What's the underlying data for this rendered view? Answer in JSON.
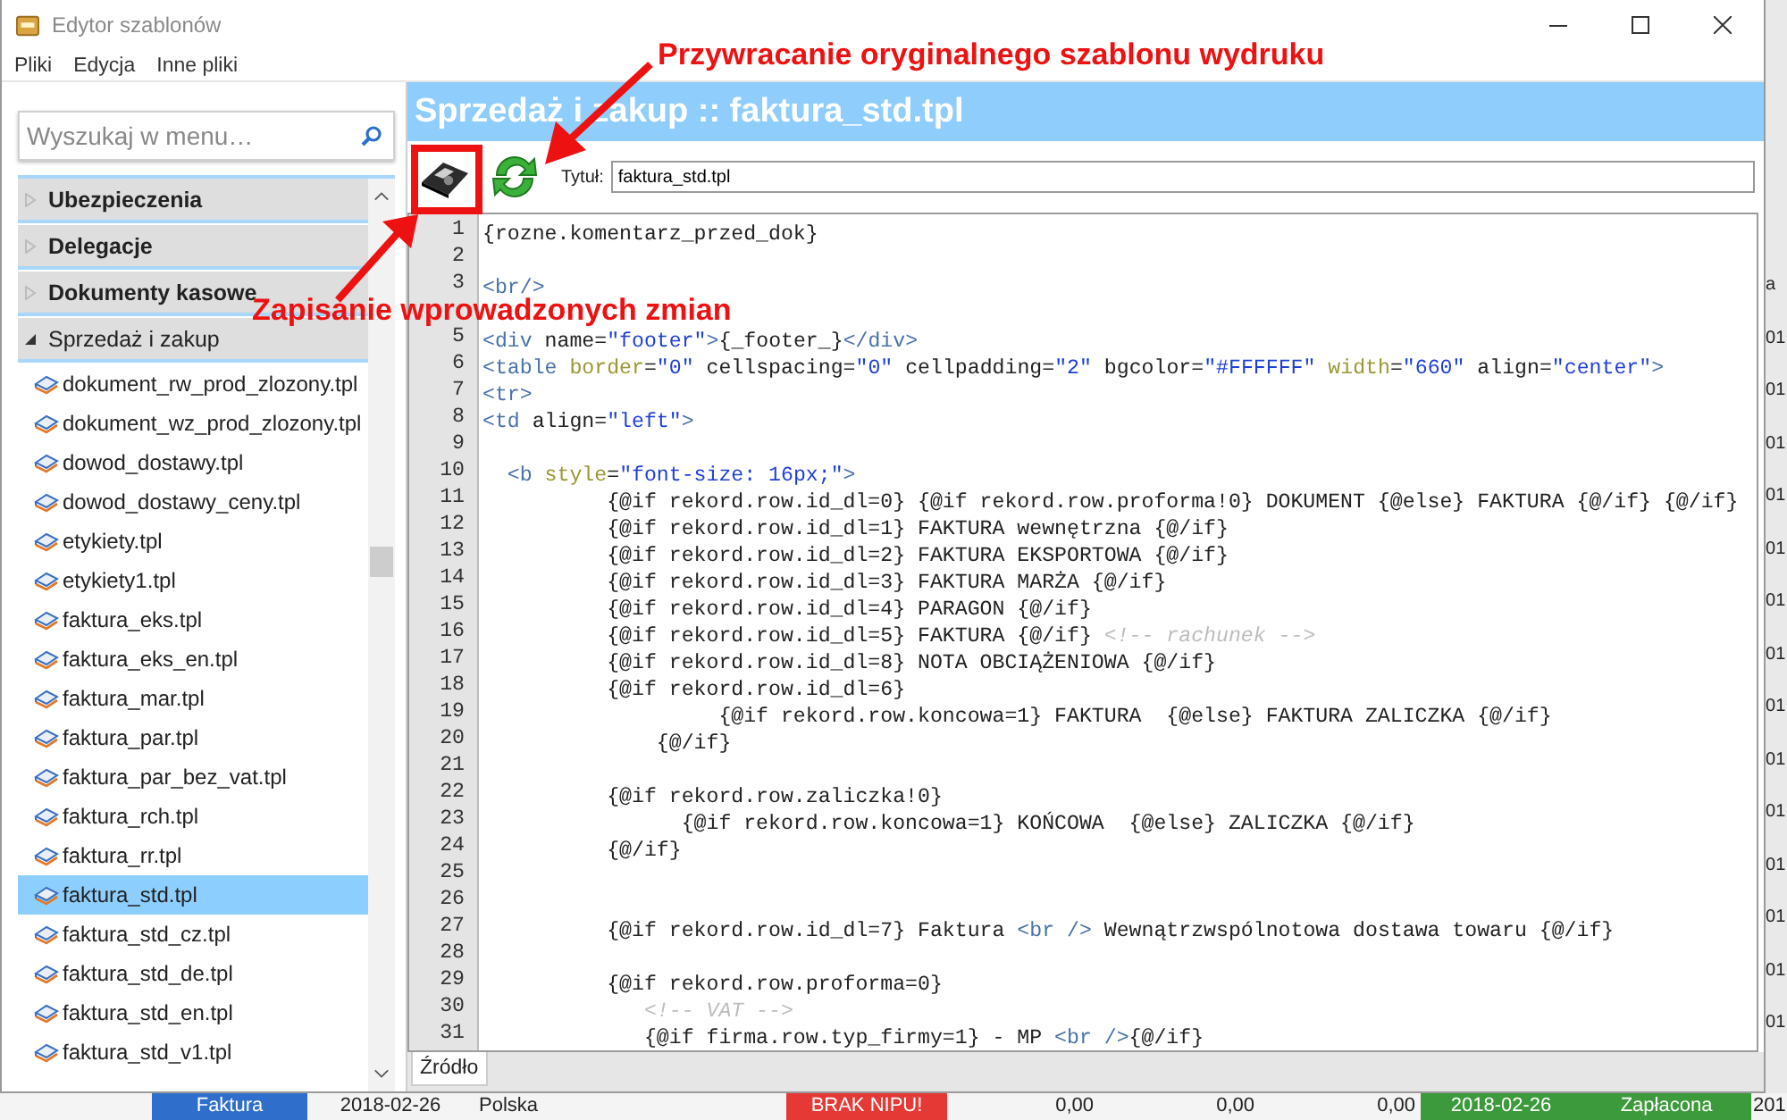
{
  "window": {
    "title": "Edytor szablonów"
  },
  "menu": [
    "Pliki",
    "Edycja",
    "Inne pliki"
  ],
  "search": {
    "placeholder": "Wyszukaj w menu…"
  },
  "tree": [
    {
      "label": "Ubezpieczenia",
      "expanded": false
    },
    {
      "label": "Delegacje",
      "expanded": false
    },
    {
      "label": "Dokumenty kasowe",
      "expanded": false
    },
    {
      "label": "Sprzedaż i zakup",
      "expanded": true,
      "children": [
        {
          "label": "dokument_rw_prod_zlozony.tpl",
          "selected": false
        },
        {
          "label": "dokument_wz_prod_zlozony.tpl",
          "selected": false
        },
        {
          "label": "dowod_dostawy.tpl",
          "selected": false
        },
        {
          "label": "dowod_dostawy_ceny.tpl",
          "selected": false
        },
        {
          "label": "etykiety.tpl",
          "selected": false
        },
        {
          "label": "etykiety1.tpl",
          "selected": false
        },
        {
          "label": "faktura_eks.tpl",
          "selected": false
        },
        {
          "label": "faktura_eks_en.tpl",
          "selected": false
        },
        {
          "label": "faktura_mar.tpl",
          "selected": false
        },
        {
          "label": "faktura_par.tpl",
          "selected": false
        },
        {
          "label": "faktura_par_bez_vat.tpl",
          "selected": false
        },
        {
          "label": "faktura_rch.tpl",
          "selected": false
        },
        {
          "label": "faktura_rr.tpl",
          "selected": false
        },
        {
          "label": "faktura_std.tpl",
          "selected": true
        },
        {
          "label": "faktura_std_cz.tpl",
          "selected": false
        },
        {
          "label": "faktura_std_de.tpl",
          "selected": false
        },
        {
          "label": "faktura_std_en.tpl",
          "selected": false
        },
        {
          "label": "faktura_std_v1.tpl",
          "selected": false
        }
      ]
    }
  ],
  "editor": {
    "heading": "Sprzedaż i zakup :: faktura_std.tpl",
    "title_label": "Tytuł:",
    "title_value": "faktura_std.tpl",
    "lines": [
      {
        "number": "1",
        "segments": [
          {
            "kind": "plain",
            "text": "{rozne.komentarz_przed_dok}"
          }
        ]
      },
      {
        "number": "2"
      },
      {
        "number": "3",
        "segments": [
          {
            "kind": "tag",
            "text": "<br/>"
          }
        ]
      },
      {
        "kind": "covered"
      },
      {
        "number": "5",
        "segments": [
          {
            "kind": "tag",
            "text": "<div"
          },
          {
            "kind": "plain",
            "text": " name="
          },
          {
            "kind": "string",
            "text": "\"footer\""
          },
          {
            "kind": "tag",
            "text": ">"
          },
          {
            "kind": "plain",
            "text": "{_footer_}"
          },
          {
            "kind": "tag",
            "text": "</div>"
          }
        ]
      },
      {
        "number": "6",
        "segments": [
          {
            "kind": "tag",
            "text": "<table"
          },
          {
            "kind": "attr",
            "text": " border"
          },
          {
            "kind": "plain",
            "text": "="
          },
          {
            "kind": "string",
            "text": "\"0\""
          },
          {
            "kind": "plain",
            "text": " cellspacing="
          },
          {
            "kind": "string",
            "text": "\"0\""
          },
          {
            "kind": "plain",
            "text": " cellpadding="
          },
          {
            "kind": "string",
            "text": "\"2\""
          },
          {
            "kind": "plain",
            "text": " bgcolor="
          },
          {
            "kind": "string",
            "text": "\"#FFFFFF\""
          },
          {
            "kind": "attr",
            "text": " width"
          },
          {
            "kind": "plain",
            "text": "="
          },
          {
            "kind": "string",
            "text": "\"660\""
          },
          {
            "kind": "plain",
            "text": " align="
          },
          {
            "kind": "string",
            "text": "\"center\""
          },
          {
            "kind": "tag",
            "text": ">"
          }
        ]
      },
      {
        "number": "7",
        "segments": [
          {
            "kind": "tag",
            "text": "<tr>"
          }
        ]
      },
      {
        "number": "8",
        "segments": [
          {
            "kind": "tag",
            "text": "<td"
          },
          {
            "kind": "plain",
            "text": " align="
          },
          {
            "kind": "string",
            "text": "\"left\""
          },
          {
            "kind": "tag",
            "text": ">"
          }
        ]
      },
      {
        "number": "9"
      },
      {
        "number": "10",
        "segments": [
          {
            "kind": "tag",
            "text": "  <b"
          },
          {
            "kind": "attr",
            "text": " style"
          },
          {
            "kind": "plain",
            "text": "="
          },
          {
            "kind": "string",
            "text": "\"font-size: 16px;\""
          },
          {
            "kind": "tag",
            "text": ">"
          }
        ]
      },
      {
        "number": "11",
        "segments": [
          {
            "kind": "plain",
            "text": "          {@if rekord.row.id_dl=0} {@if rekord.row.proforma!0} DOKUMENT {@else} FAKTURA {@/if} {@/if}"
          }
        ]
      },
      {
        "number": "12",
        "segments": [
          {
            "kind": "plain",
            "text": "          {@if rekord.row.id_dl=1} FAKTURA wewnętrzna {@/if}"
          }
        ]
      },
      {
        "number": "13",
        "segments": [
          {
            "kind": "plain",
            "text": "          {@if rekord.row.id_dl=2} FAKTURA EKSPORTOWA {@/if}"
          }
        ]
      },
      {
        "number": "14",
        "segments": [
          {
            "kind": "plain",
            "text": "          {@if rekord.row.id_dl=3} FAKTURA MARŻA {@/if}"
          }
        ]
      },
      {
        "number": "15",
        "segments": [
          {
            "kind": "plain",
            "text": "          {@if rekord.row.id_dl=4} PARAGON {@/if}"
          }
        ]
      },
      {
        "number": "16",
        "segments": [
          {
            "kind": "plain",
            "text": "          {@if rekord.row.id_dl=5} FAKTURA {@/if} "
          },
          {
            "kind": "comment",
            "text": "<!-- rachunek -->"
          }
        ]
      },
      {
        "number": "17",
        "segments": [
          {
            "kind": "plain",
            "text": "          {@if rekord.row.id_dl=8} NOTA OBCIĄŻENIOWA {@/if}"
          }
        ]
      },
      {
        "number": "18",
        "segments": [
          {
            "kind": "plain",
            "text": "          {@if rekord.row.id_dl=6}"
          }
        ]
      },
      {
        "number": "19",
        "segments": [
          {
            "kind": "plain",
            "text": "                   {@if rekord.row.koncowa=1} FAKTURA  {@else} FAKTURA ZALICZKA {@/if}"
          }
        ]
      },
      {
        "number": "20",
        "segments": [
          {
            "kind": "plain",
            "text": "              {@/if}"
          }
        ]
      },
      {
        "number": "21"
      },
      {
        "number": "22",
        "segments": [
          {
            "kind": "plain",
            "text": "          {@if rekord.row.zaliczka!0}"
          }
        ]
      },
      {
        "number": "23",
        "segments": [
          {
            "kind": "plain",
            "text": "                {@if rekord.row.koncowa=1} KOŃCOWA  {@else} ZALICZKA {@/if}"
          }
        ]
      },
      {
        "number": "24",
        "segments": [
          {
            "kind": "plain",
            "text": "          {@/if}"
          }
        ]
      },
      {
        "number": "25"
      },
      {
        "number": "26"
      },
      {
        "number": "27",
        "segments": [
          {
            "kind": "plain",
            "text": "          {@if rekord.row.id_dl=7} Faktura "
          },
          {
            "kind": "tag",
            "text": "<br />"
          },
          {
            "kind": "plain",
            "text": " Wewnątrzwspólnotowa dostawa towaru {@/if}"
          }
        ]
      },
      {
        "number": "28"
      },
      {
        "number": "29",
        "segments": [
          {
            "kind": "plain",
            "text": "          {@if rekord.row.proforma=0}"
          }
        ]
      },
      {
        "number": "30",
        "segments": [
          {
            "kind": "comment",
            "text": "             <!-- VAT -->"
          }
        ]
      },
      {
        "number": "31",
        "segments": [
          {
            "kind": "plain",
            "text": "             {@if firma.row.typ_firmy=1} - MP "
          },
          {
            "kind": "tag",
            "text": "<br />"
          },
          {
            "kind": "plain",
            "text": "{@/if}"
          }
        ]
      }
    ],
    "tabs": [
      {
        "label": "Źródło",
        "selected": true
      }
    ]
  },
  "annotations": [
    {
      "text": "Przywracanie oryginalnego szablonu wydruku"
    },
    {
      "text": "Zapisanie wprowadzonych zmian"
    }
  ],
  "background_app": {
    "column_header": "a",
    "column_cells": [
      "01",
      "01",
      "01",
      "01",
      "01",
      "01",
      "01",
      "01",
      "01",
      "01",
      "01",
      "01",
      "01",
      "01"
    ],
    "row": [
      {
        "text": "Faktura",
        "color": "#2f6fcb"
      },
      {
        "text": "2018-02-26"
      },
      {
        "text": "Polska"
      },
      {
        "text": "BRAK NIPU!",
        "color": "#e53935"
      },
      {
        "text": "0,00"
      },
      {
        "text": "0,00"
      },
      {
        "text": "0,00"
      },
      {
        "text": "2018-02-26",
        "color": "#3c9a3c"
      },
      {
        "text": "Zapłacona",
        "color": "#3c9a3c"
      },
      {
        "text": "201"
      }
    ]
  }
}
